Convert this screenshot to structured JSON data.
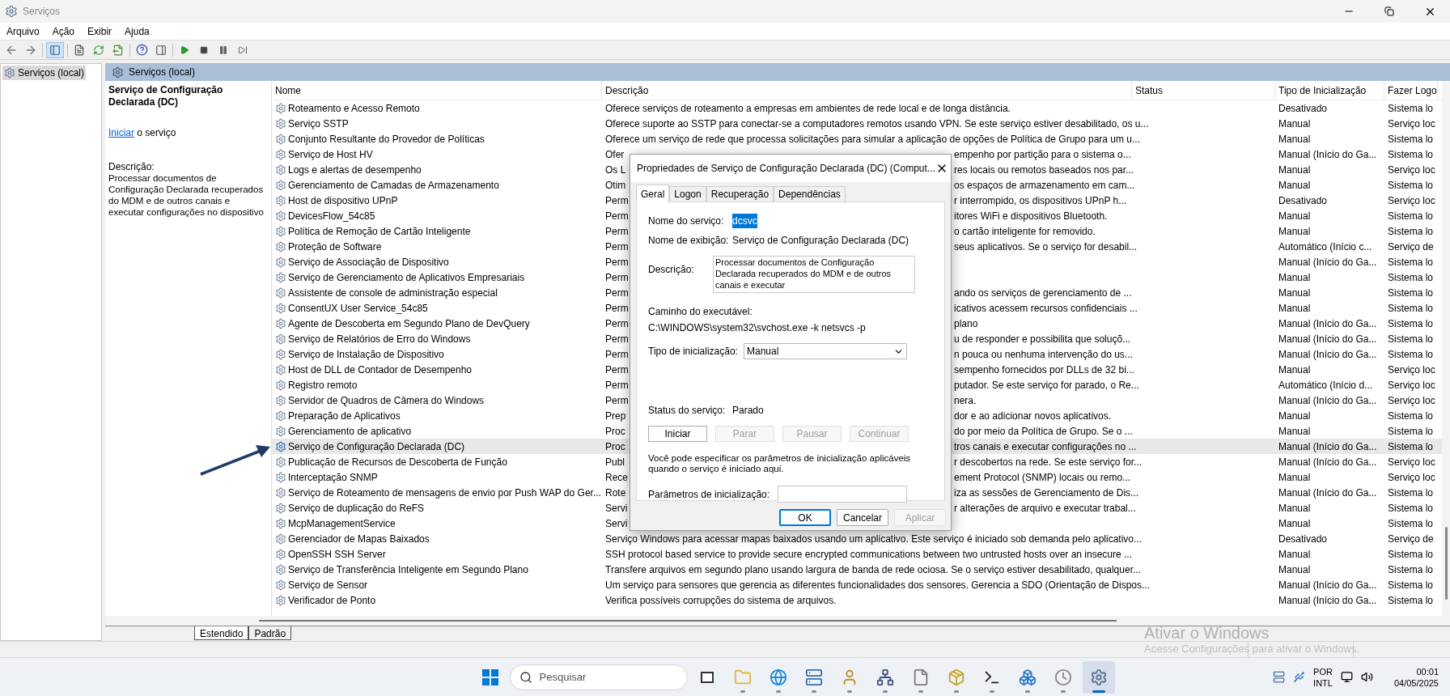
{
  "window": {
    "title": "Serviços",
    "menu": [
      "Arquivo",
      "Ação",
      "Exibir",
      "Ajuda"
    ]
  },
  "tree": {
    "items": [
      {
        "label": "Serviços (local)",
        "selected": true
      }
    ]
  },
  "panel_header": "Serviços (local)",
  "details": {
    "title": "Serviço de Configuração Declarada (DC)",
    "action_link": "Iniciar",
    "action_rest": "o serviço",
    "description_label": "Descrição:",
    "description": "Processar documentos de Configuração Declarada recuperados do MDM e de outros canais e executar configurações no dispositivo"
  },
  "table": {
    "columns": [
      "Nome",
      "Descrição",
      "Status",
      "Tipo de Inicialização",
      "Fazer Logo"
    ],
    "rows": [
      {
        "name": "Roteamento e Acesso Remoto",
        "description": "Oferece serviços de roteamento a empresas em ambientes de rede local e de longa distância.",
        "startup": "Desativado",
        "logon": "Sistema lo",
        "selected": false
      },
      {
        "name": "Serviço SSTP",
        "description": "Oferece suporte ao SSTP para conectar-se a computadores remotos usando VPN. Se este serviço estiver desabilitado, os u...",
        "startup": "Manual",
        "logon": "Serviço loc",
        "selected": false
      },
      {
        "name": "Conjunto Resultante do Provedor de Políticas",
        "description": "Oferece um serviço de rede que processa solicitações para simular a aplicação de opções de Política de Grupo para um u...",
        "startup": "Manual",
        "logon": "Sistema lo",
        "selected": false
      },
      {
        "name": "Serviço de Host HV",
        "description": "Ofer",
        "description_tail": "empenho por partição para o sistema o...",
        "startup": "Manual (Início do Ga...",
        "logon": "Sistema lo",
        "selected": false
      },
      {
        "name": "Logs e alertas de desempenho",
        "description": "Os L",
        "description_tail": "res locais ou remotos baseados nos par...",
        "startup": "Manual",
        "logon": "Serviço loc",
        "selected": false
      },
      {
        "name": "Gerenciamento de Camadas de Armazenamento",
        "description": "Otim",
        "description_tail": "os espaços de armazenamento em cam...",
        "startup": "Manual",
        "logon": "Sistema lo",
        "selected": false
      },
      {
        "name": "Host de dispositivo UPnP",
        "description": "Perm",
        "description_tail": "r interrompido, os dispositivos UPnP h...",
        "startup": "Desativado",
        "logon": "Serviço loc",
        "selected": false
      },
      {
        "name": "DevicesFlow_54c85",
        "description": "Perm",
        "description_tail": "itores WiFi e dispositivos Bluetooth.",
        "startup": "Manual",
        "logon": "Sistema lo",
        "selected": false
      },
      {
        "name": "Política de Remoção de Cartão Inteligente",
        "description": "Perm",
        "description_tail": "o cartão inteligente for removido.",
        "startup": "Manual",
        "logon": "Sistema lo",
        "selected": false
      },
      {
        "name": "Proteção de Software",
        "description": "Perm",
        "description_tail": "seus aplicativos. Se o serviço for desabil...",
        "startup": "Automático (Início c...",
        "logon": "Serviço de",
        "selected": false
      },
      {
        "name": "Serviço de Associação de Dispositivo",
        "description": "Perm",
        "startup": "Manual (Início do Ga...",
        "logon": "Sistema lo",
        "selected": false
      },
      {
        "name": "Serviço de Gerenciamento de Aplicativos Empresariais",
        "description": "Perm",
        "startup": "Manual",
        "logon": "Sistema lo",
        "selected": false
      },
      {
        "name": "Assistente de console de administração especial",
        "description": "Perm",
        "description_tail": "ando os serviços de gerenciamento de ...",
        "startup": "Manual",
        "logon": "Sistema lo",
        "selected": false
      },
      {
        "name": "ConsentUX User Service_54c85",
        "description": "Perm",
        "description_tail": "icativos acessem recursos confidenciais ...",
        "startup": "Manual",
        "logon": "Sistema lo",
        "selected": false
      },
      {
        "name": "Agente de Descoberta em Segundo Plano de DevQuery",
        "description": "Perm",
        "description_tail": "plano",
        "startup": "Manual (Início do Ga...",
        "logon": "Sistema lo",
        "selected": false
      },
      {
        "name": "Serviço de Relatórios de Erro do Windows",
        "description": "Perm",
        "description_tail": "u de responder e possibilita que soluçõ...",
        "startup": "Manual (Início do Ga...",
        "logon": "Sistema lo",
        "selected": false
      },
      {
        "name": "Serviço de Instalação de Dispositivo",
        "description": "Perm",
        "description_tail": "n pouca ou nenhuma intervenção do us...",
        "startup": "Manual (Início do Ga...",
        "logon": "Sistema lo",
        "selected": false
      },
      {
        "name": "Host de DLL de Contador de Desempenho",
        "description": "Perm",
        "description_tail": "sempenho fornecidos por DLLs de 32 bi...",
        "startup": "Manual",
        "logon": "Serviço loc",
        "selected": false
      },
      {
        "name": "Registro remoto",
        "description": "Perm",
        "description_tail": "putador. Se este serviço for parado, o Re...",
        "startup": "Automático (Início d...",
        "logon": "Serviço loc",
        "selected": false
      },
      {
        "name": "Servidor de Quadros de Câmera do Windows",
        "description": "Perm",
        "description_tail": "nera.",
        "startup": "Manual (Início do Ga...",
        "logon": "Serviço loc",
        "selected": false
      },
      {
        "name": "Preparação de Aplicativos",
        "description": "Prep",
        "description_tail": "dor e ao adicionar novos aplicativos.",
        "startup": "Manual",
        "logon": "Sistema lo",
        "selected": false
      },
      {
        "name": "Gerenciamento de aplicativo",
        "description": "Proc",
        "description_tail": "do por meio da Política de Grupo. Se o ...",
        "startup": "Manual",
        "logon": "Sistema lo",
        "selected": false
      },
      {
        "name": "Serviço de Configuração Declarada (DC)",
        "description": "Proc",
        "description_tail": "tros canais e executar configurações no ...",
        "startup": "Manual (Início do Ga...",
        "logon": "Sistema lo",
        "selected": true
      },
      {
        "name": "Publicação de Recursos de Descoberta de Função",
        "description": "Publ",
        "description_tail": "r descobertos na rede. Se este serviço for...",
        "startup": "Manual (Início do Ga...",
        "logon": "Serviço loc",
        "selected": false
      },
      {
        "name": "Interceptação SNMP",
        "description": "Rece",
        "description_tail": "ement Protocol (SNMP) locais ou remo...",
        "startup": "Manual",
        "logon": "Serviço loc",
        "selected": false
      },
      {
        "name": "Serviço de Roteamento de mensagens de envio por Push WAP do Ger...",
        "description": "Rote",
        "description_tail": "iza as sessões de Gerenciamento de Dis...",
        "startup": "Manual (Início do Ga...",
        "logon": "Sistema lo",
        "selected": false
      },
      {
        "name": "Serviço de duplicação do ReFS",
        "description": "Servi",
        "description_tail": "r alterações de arquivo e executar trabal...",
        "startup": "Manual",
        "logon": "Sistema lo",
        "selected": false
      },
      {
        "name": "McpManagementService",
        "description": "Servi",
        "startup": "Manual",
        "logon": "Sistema lo",
        "selected": false
      },
      {
        "name": "Gerenciador de Mapas Baixados",
        "description": "Serviço Windows para acessar mapas baixados usando um aplicativo. Este serviço é iniciado sob demanda pelo aplicativo...",
        "startup": "Desativado",
        "logon": "Serviço de",
        "selected": false
      },
      {
        "name": "OpenSSH SSH Server",
        "description": "SSH protocol based service to provide secure encrypted communications between two untrusted hosts over an insecure ...",
        "startup": "Manual",
        "logon": "Sistema lo",
        "selected": false
      },
      {
        "name": "Serviço de Transferência Inteligente em Segundo Plano",
        "description": "Transfere arquivos em segundo plano usando largura de banda de rede ociosa. Se o serviço estiver desabilitado, qualquer...",
        "startup": "Manual",
        "logon": "Sistema lo",
        "selected": false
      },
      {
        "name": "Serviço de Sensor",
        "description": "Um serviço para sensores que gerencia as diferentes funcionalidades dos sensores. Gerencia a SDO (Orientação de Dispos...",
        "startup": "Manual (Início do Ga...",
        "logon": "Sistema lo",
        "selected": false
      },
      {
        "name": "Verificador de Ponto",
        "description": "Verifica possíveis corrupções do sistema de arquivos.",
        "startup": "Manual (Início do Ga...",
        "logon": "Sistema lo",
        "selected": false
      }
    ]
  },
  "view_tabs": [
    {
      "label": "Estendido",
      "selected": true
    },
    {
      "label": "Padrão",
      "selected": false
    }
  ],
  "dialog": {
    "title": "Propriedades de Serviço de Configuração Declarada (DC) (Comput...",
    "tabs": [
      {
        "label": "Geral",
        "selected": true
      },
      {
        "label": "Logon",
        "selected": false
      },
      {
        "label": "Recuperação",
        "selected": false
      },
      {
        "label": "Dependências",
        "selected": false
      }
    ],
    "service_name_label": "Nome do serviço:",
    "service_name": "dcsvc",
    "service_name_highlighted": true,
    "display_name_label": "Nome de exibição:",
    "display_name": "Serviço de Configuração Declarada (DC)",
    "description_label": "Descrição:",
    "description": "Processar documentos de Configuração Declarada recuperados do MDM e de outros canais e executar",
    "executable_label": "Caminho do executável:",
    "executable_path": "C:\\WINDOWS\\system32\\svchost.exe -k netsvcs -p",
    "startup_label": "Tipo de inicialização:",
    "startup_value": "Manual",
    "status_label": "Status do serviço:",
    "status": "Parado",
    "control_buttons": [
      {
        "label": "Iniciar",
        "disabled": false
      },
      {
        "label": "Parar",
        "disabled": true
      },
      {
        "label": "Pausar",
        "disabled": true
      },
      {
        "label": "Continuar",
        "disabled": true
      }
    ],
    "hint": "Você pode especificar os parâmetros de inicialização aplicáveis quando o serviço é iniciado aqui.",
    "params_label": "Parâmetros de inicialização:",
    "footer_buttons": [
      {
        "label": "OK",
        "disabled": false,
        "default": true
      },
      {
        "label": "Cancelar",
        "disabled": false,
        "default": false
      },
      {
        "label": "Aplicar",
        "disabled": true,
        "default": false
      }
    ]
  },
  "activation_notice": {
    "title": "Ativar o Windows",
    "text": "Acesse Configurações para ativar o Windows."
  },
  "taskbar": {
    "search_placeholder": "Pesquisar",
    "apps": [
      {
        "kind": "taskview",
        "active": false
      },
      {
        "kind": "folder",
        "active": false
      },
      {
        "kind": "browser",
        "active": false
      },
      {
        "kind": "server",
        "active": false
      },
      {
        "kind": "user",
        "active": false
      },
      {
        "kind": "network",
        "active": false
      },
      {
        "kind": "document",
        "active": false
      },
      {
        "kind": "package",
        "active": false
      },
      {
        "kind": "terminal",
        "active": false
      },
      {
        "kind": "cubes",
        "active": false
      },
      {
        "kind": "clock",
        "active": false
      },
      {
        "kind": "gear",
        "active": true
      }
    ],
    "language": "POR",
    "layout": "INTL",
    "time": "00:01",
    "date": "04/05/2025"
  }
}
